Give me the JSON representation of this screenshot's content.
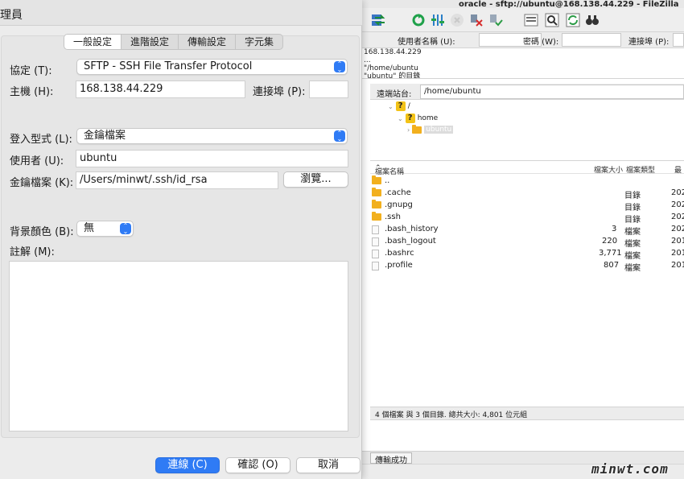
{
  "filezilla": {
    "title": "oracle - sftp://ubuntu@168.138.44.229 - FileZilla",
    "quickconnect": {
      "user_label": "使用者名稱 (U):",
      "password_label": "密碼 (W):",
      "port_label": "連接埠 (P):"
    },
    "log_lines": [
      "168.138.44.229",
      "...",
      "\"/home/ubuntu",
      "\"ubuntu\" 的目錄"
    ],
    "remote_site_label": "遠端站台:",
    "remote_path": "/home/ubuntu",
    "tree": {
      "root": "/",
      "home": "home",
      "ubuntu": "ubuntu"
    },
    "columns": {
      "name": "檔案名稱",
      "size": "檔案大小",
      "type": "檔案類型",
      "modified": "最"
    },
    "files": [
      {
        "name": "..",
        "size": "",
        "type": "",
        "modified": "",
        "icon": "folder-icon"
      },
      {
        "name": ".cache",
        "size": "",
        "type": "目錄",
        "modified": "202",
        "icon": "folder-icon"
      },
      {
        "name": ".gnupg",
        "size": "",
        "type": "目錄",
        "modified": "202",
        "icon": "folder-icon"
      },
      {
        "name": ".ssh",
        "size": "",
        "type": "目錄",
        "modified": "202",
        "icon": "folder-icon"
      },
      {
        "name": ".bash_history",
        "size": "3",
        "type": "檔案",
        "modified": "202",
        "icon": "file-icon"
      },
      {
        "name": ".bash_logout",
        "size": "220",
        "type": "檔案",
        "modified": "201",
        "icon": "file-icon"
      },
      {
        "name": ".bashrc",
        "size": "3,771",
        "type": "檔案",
        "modified": "201",
        "icon": "file-icon"
      },
      {
        "name": ".profile",
        "size": "807",
        "type": "檔案",
        "modified": "201",
        "icon": "file-icon"
      }
    ],
    "status_summary": "4 個檔案 與 3 個目錄. 總共大小: 4,801 位元組",
    "bottom_tab": "傳輸成功",
    "watermark": "minwt.com"
  },
  "site_manager": {
    "title": "理員",
    "tabs": [
      "一般設定",
      "進階設定",
      "傳輸設定",
      "字元集"
    ],
    "active_tab": 0,
    "protocol_label": "協定 (T):",
    "protocol_value": "SFTP - SSH File Transfer Protocol",
    "host_label": "主機 (H):",
    "host_value": "168.138.44.229",
    "port_label": "連接埠 (P):",
    "port_value": "",
    "logon_type_label": "登入型式 (L):",
    "logon_type_value": "金鑰檔案",
    "user_label": "使用者 (U):",
    "user_value": "ubuntu",
    "keyfile_label": "金鑰檔案 (K):",
    "keyfile_value": "/Users/minwt/.ssh/id_rsa",
    "browse_button": "瀏覽...",
    "bgcolor_label": "背景顏色 (B):",
    "bgcolor_value": "無",
    "comments_label": "註解 (M):",
    "connect_button": "連線 (C)",
    "ok_button": "確認 (O)",
    "cancel_button": "取消"
  },
  "colors": {
    "accent": "#2f7bf5",
    "folder": "#f2b01e",
    "question": "#f3c317"
  }
}
